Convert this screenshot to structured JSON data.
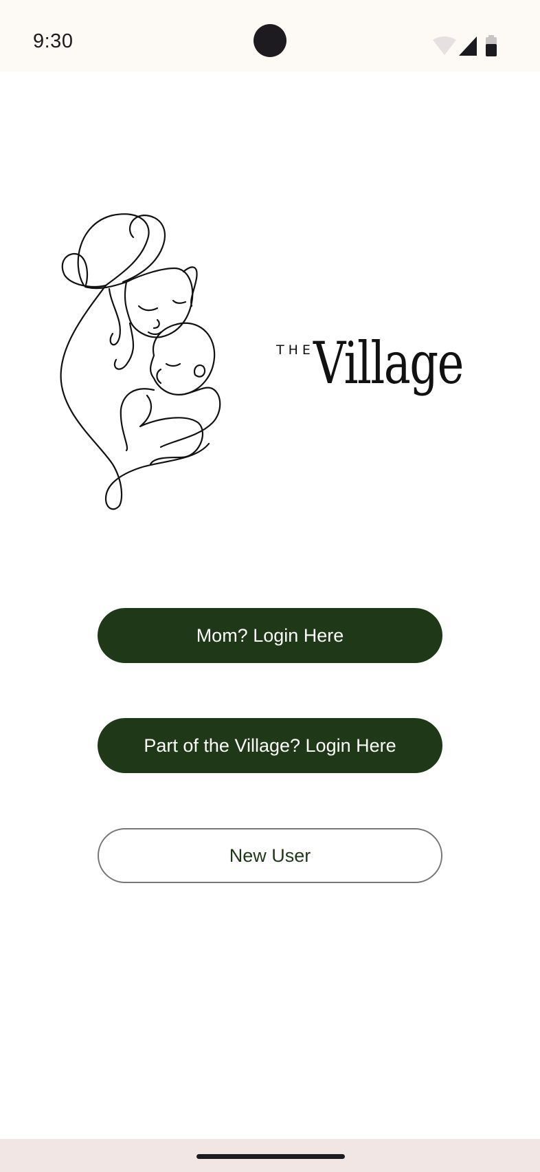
{
  "status_bar": {
    "time": "9:30",
    "icons": [
      "wifi-icon",
      "cellular-signal-icon",
      "battery-icon"
    ]
  },
  "logo": {
    "prefix": "THE",
    "name": "Village"
  },
  "buttons": {
    "mom_login": "Mom? Login Here",
    "village_login": "Part of the Village? Login Here",
    "new_user": "New User"
  },
  "colors": {
    "primary": "#1f3817",
    "status_bar_bg": "#fdf9f4",
    "nav_bar_bg": "#f1e6e3",
    "outline": "#76767a"
  }
}
